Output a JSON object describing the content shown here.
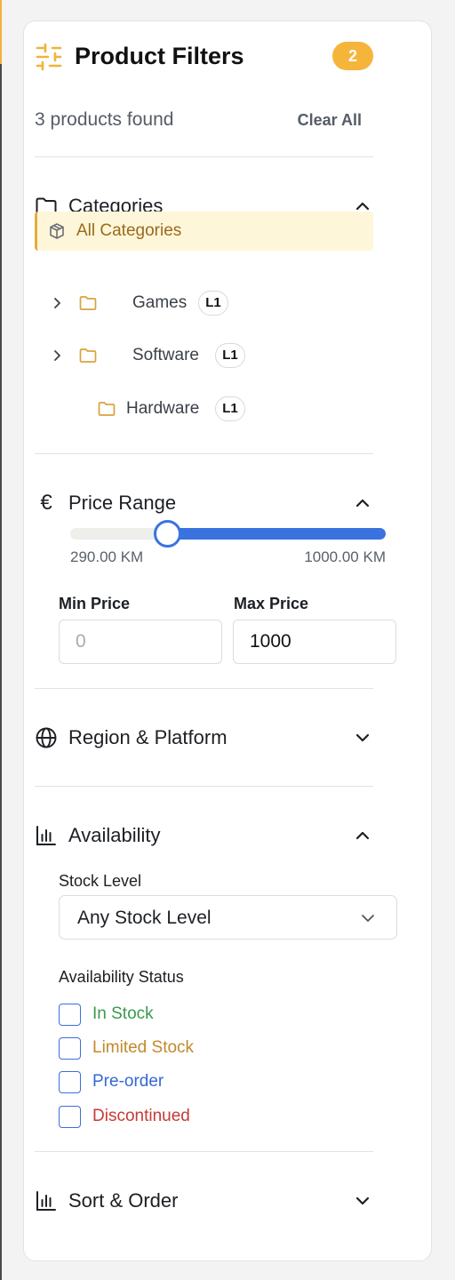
{
  "header": {
    "title": "Product Filters",
    "active_count": "2",
    "results_text": "3 products found",
    "clear_all_label": "Clear All"
  },
  "categories": {
    "title": "Categories",
    "all_label": "All Categories",
    "items": [
      {
        "label": "Games",
        "level": "L1",
        "has_children": true
      },
      {
        "label": "Software",
        "level": "L1",
        "has_children": true
      },
      {
        "label": "Hardware",
        "level": "L1",
        "has_children": false
      }
    ]
  },
  "price": {
    "title": "Price Range",
    "currency_symbol": "€",
    "range_min_label": "290.00 KM",
    "range_max_label": "1000.00 KM",
    "slider_min": 0,
    "slider_max": 1000,
    "selected_low": 290,
    "selected_high": 1000,
    "min_price_label": "Min Price",
    "min_price_placeholder": "0",
    "min_price_value": "",
    "max_price_label": "Max Price",
    "max_price_value": "1000"
  },
  "region": {
    "title": "Region & Platform"
  },
  "availability": {
    "title": "Availability",
    "stock_level_label": "Stock Level",
    "stock_level_value": "Any Stock Level",
    "status_label": "Availability Status",
    "statuses": [
      {
        "label": "In Stock",
        "color": "#3b9a4c",
        "checked": false
      },
      {
        "label": "Limited Stock",
        "color": "#c28a2c",
        "checked": false
      },
      {
        "label": "Pre-order",
        "color": "#3468d4",
        "checked": false
      },
      {
        "label": "Discontinued",
        "color": "#c63a36",
        "checked": false
      }
    ]
  },
  "sort": {
    "title": "Sort & Order"
  },
  "colors": {
    "accent": "#f5b53b",
    "slider": "#3a72e0",
    "selected_bg": "#fef6d9"
  },
  "icons": {
    "header": "sliders-icon",
    "categories": "folder-icon",
    "price": "euro-icon",
    "region": "globe-icon",
    "availability": "bar-chart-icon",
    "sort": "bar-chart-icon"
  }
}
